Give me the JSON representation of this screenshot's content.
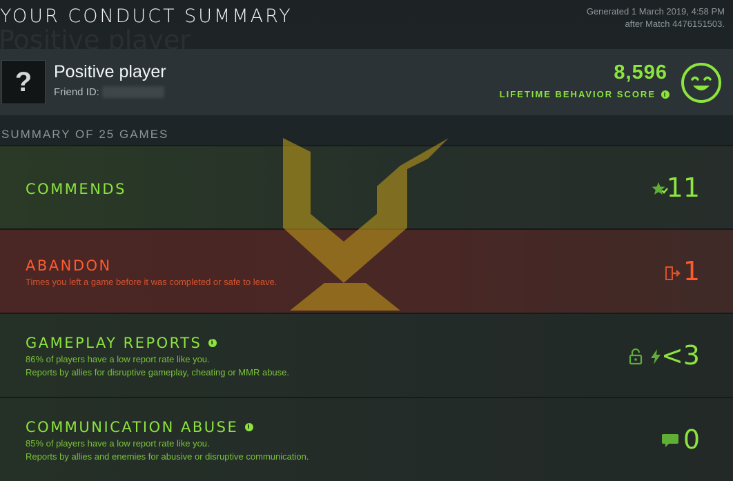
{
  "header": {
    "title": "YOUR CONDUCT SUMMARY",
    "watermark": "Positive player",
    "generated_line1": "Generated 1 March 2019, 4:58 PM",
    "generated_line2": "after Match 4476151503."
  },
  "player": {
    "avatar_char": "?",
    "name": "Positive player",
    "friend_id_label": "Friend ID:",
    "score": "8,596",
    "score_label": "LIFETIME BEHAVIOR SCORE",
    "info_glyph": "i"
  },
  "summary": {
    "header": "SUMMARY OF 25 GAMES",
    "rows": [
      {
        "title": "COMMENDS",
        "value": "11",
        "icon": "star-commend-icon"
      },
      {
        "title": "ABANDON",
        "sub1": "Times you left a game before it was completed or safe to leave.",
        "value": "1",
        "icon": "exit-door-icon"
      },
      {
        "title": "GAMEPLAY REPORTS",
        "sub1": "86% of players have a low report rate like you.",
        "sub2": "Reports by allies for disruptive gameplay, cheating or MMR abuse.",
        "value": "<3",
        "icon": "lock-lightning-icon"
      },
      {
        "title": "COMMUNICATION ABUSE",
        "sub1": "85% of players have a low report rate like you.",
        "sub2": "Reports by allies and enemies for abusive or disruptive communication.",
        "value": "0",
        "icon": "chat-bubble-icon"
      }
    ]
  },
  "colors": {
    "positive": "#8ce43e",
    "negative": "#ff5a2e",
    "logo": "#c9a21a"
  }
}
